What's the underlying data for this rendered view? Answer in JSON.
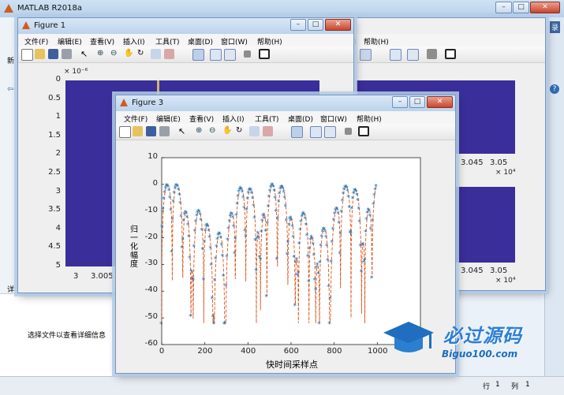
{
  "main_window": {
    "title": "MATLAB R2018a",
    "right_strip_labels": [
      "录",
      "?"
    ],
    "left_labels": [
      "新",
      "详"
    ],
    "detail_info": "选择文件以查看详细信息",
    "status": {
      "row_label": "行",
      "row_value": "1",
      "col_label": "列",
      "col_value": "1"
    }
  },
  "menu_items": [
    "文件(F)",
    "编辑(E)",
    "查看(V)",
    "插入(I)",
    "工具(T)",
    "桌面(D)",
    "窗口(W)",
    "帮助(H)"
  ],
  "figure1": {
    "title": "Figure 1",
    "exponent_label": "× 10⁻⁶",
    "y_ticks": [
      "0",
      "0.5",
      "1",
      "1.5",
      "2",
      "2.5",
      "3",
      "3.5",
      "4",
      "4.5",
      "5"
    ],
    "x_ticks": [
      "3",
      "3.005"
    ]
  },
  "figure2": {
    "top_x_ticks": [
      "3.045",
      "3.05"
    ],
    "top_exp": "× 10⁴",
    "bottom_x_ticks": [
      "3.045",
      "3.05"
    ],
    "bottom_exp": "× 10⁴"
  },
  "figure3": {
    "title": "Figure 3",
    "ylabel": "归一化幅度",
    "xlabel": "快时间采样点",
    "y_ticks": [
      "10",
      "0",
      "-10",
      "-20",
      "-30",
      "-40",
      "-50",
      "-60"
    ],
    "x_ticks": [
      "0",
      "200",
      "400",
      "600",
      "800",
      "1000"
    ]
  },
  "watermark": {
    "main": "必过源码",
    "sub": "Biguo100.com"
  },
  "chart_data": {
    "type": "line",
    "x_range": [
      0,
      1200
    ],
    "ylim": [
      -60,
      10
    ],
    "xlabel": "快时间采样点",
    "ylabel": "归一化幅度",
    "series": [
      {
        "style": "dashed line",
        "color": "#d9541a"
      },
      {
        "style": "asterisk markers",
        "color": "#1f73b8"
      }
    ],
    "range_of_data_x": [
      0,
      1000
    ],
    "lobe_peak_value": 0
  },
  "colors": {
    "plot_dark": "#3a2e9a",
    "plot_line": "#d9541a",
    "plot_marker": "#1f73b8"
  }
}
